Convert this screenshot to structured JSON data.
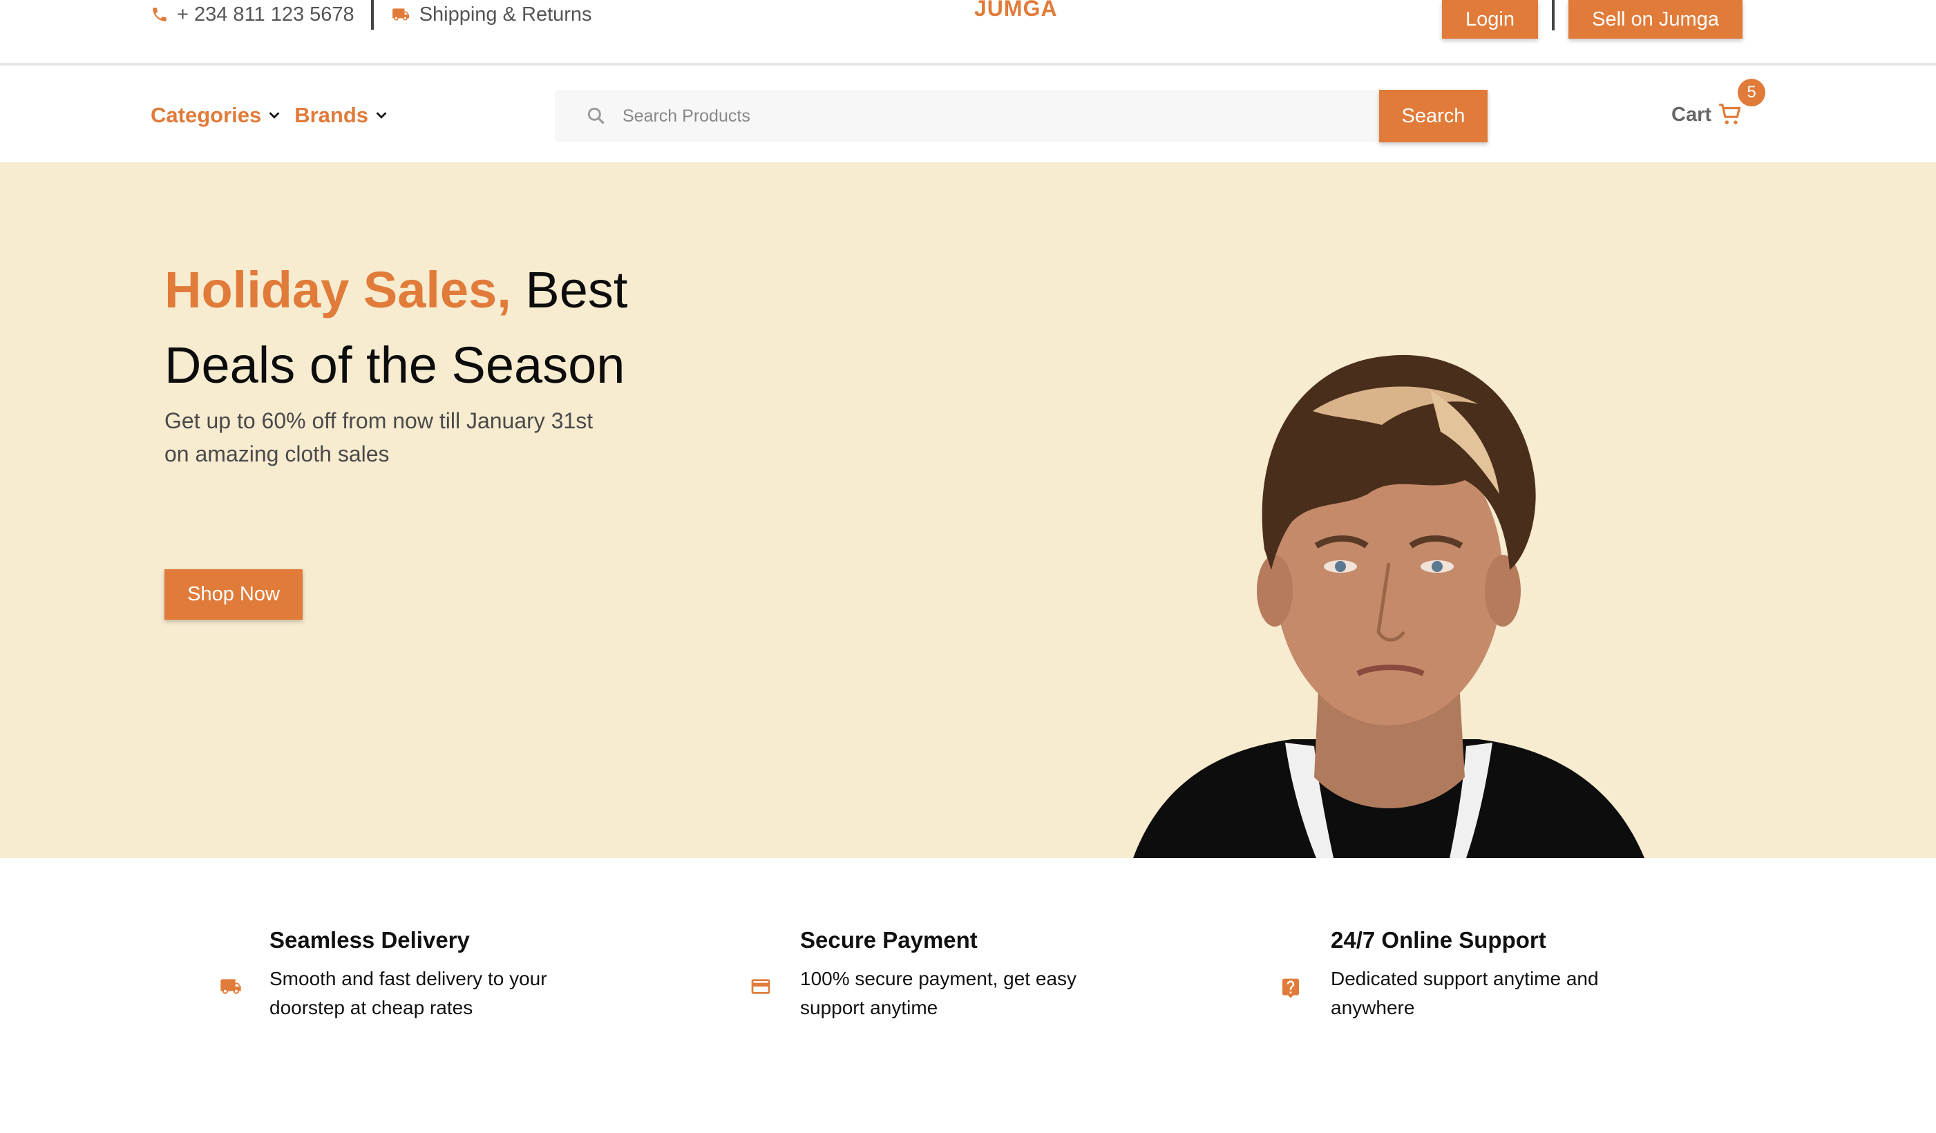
{
  "topbar": {
    "phone": "+ 234 811 123 5678",
    "shipping_label": "Shipping & Returns",
    "logo": "JUMGA",
    "login_label": "Login",
    "sell_label": "Sell on Jumga"
  },
  "nav": {
    "categories_label": "Categories",
    "brands_label": "Brands",
    "search_placeholder": "Search Products",
    "search_button": "Search",
    "cart_label": "Cart",
    "cart_count": "5"
  },
  "hero": {
    "title_accent": "Holiday Sales,",
    "title_rest": " Best Deals of the Season",
    "subtitle": "Get up to 60% off from now till January 31st on amazing cloth sales",
    "cta_label": "Shop Now"
  },
  "features": [
    {
      "title": "Seamless Delivery",
      "text": "Smooth and fast delivery to your doorstep at cheap rates",
      "icon": "truck-icon"
    },
    {
      "title": "Secure Payment",
      "text": "100% secure payment, get easy support anytime",
      "icon": "credit-card-icon"
    },
    {
      "title": "24/7 Online Support",
      "text": "Dedicated support anytime and anywhere",
      "icon": "help-icon"
    }
  ],
  "colors": {
    "accent": "#e07b39",
    "hero_bg": "#f7ebd0"
  }
}
